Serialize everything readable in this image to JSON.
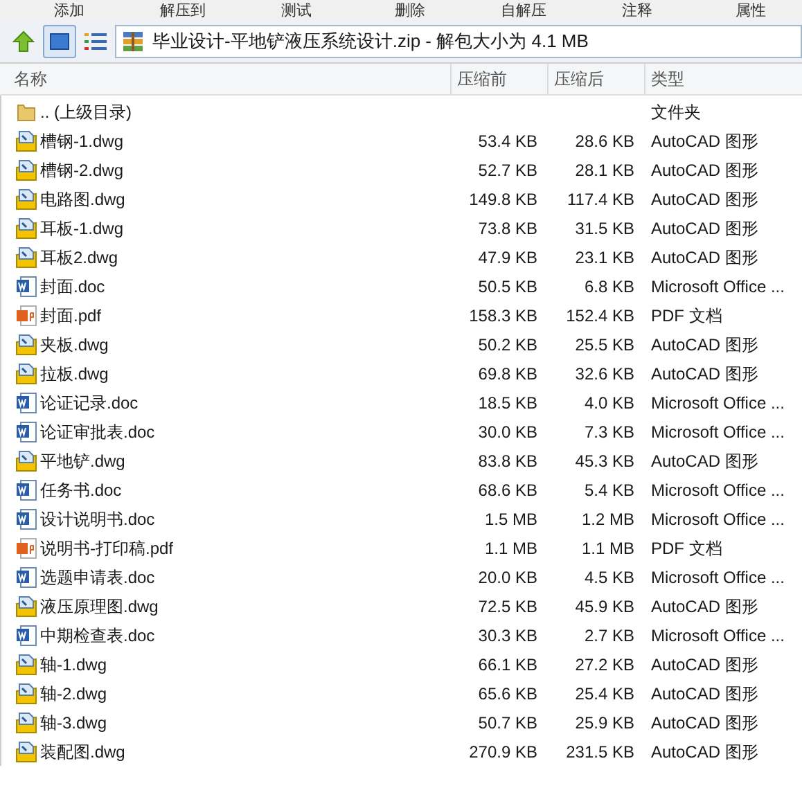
{
  "toolbar": [
    "添加",
    "解压到",
    "测试",
    "删除",
    "自解压",
    "注释",
    "属性"
  ],
  "address": "毕业设计-平地铲液压系统设计.zip - 解包大小为 4.1 MB",
  "columns": [
    "名称",
    "压缩前",
    "压缩后",
    "类型"
  ],
  "rows": [
    {
      "kind": "folder",
      "name": ".. (上级目录)",
      "type": "文件夹"
    },
    {
      "kind": "dwg",
      "name": "槽钢-1.dwg",
      "size": "53.4 KB",
      "packed": "28.6 KB",
      "type": "AutoCAD 图形"
    },
    {
      "kind": "dwg",
      "name": "槽钢-2.dwg",
      "size": "52.7 KB",
      "packed": "28.1 KB",
      "type": "AutoCAD 图形"
    },
    {
      "kind": "dwg",
      "name": "电路图.dwg",
      "size": "149.8 KB",
      "packed": "117.4 KB",
      "type": "AutoCAD 图形"
    },
    {
      "kind": "dwg",
      "name": "耳板-1.dwg",
      "size": "73.8 KB",
      "packed": "31.5 KB",
      "type": "AutoCAD 图形"
    },
    {
      "kind": "dwg",
      "name": "耳板2.dwg",
      "size": "47.9 KB",
      "packed": "23.1 KB",
      "type": "AutoCAD 图形"
    },
    {
      "kind": "doc",
      "name": "封面.doc",
      "size": "50.5 KB",
      "packed": "6.8 KB",
      "type": "Microsoft Office ..."
    },
    {
      "kind": "pdf",
      "name": "封面.pdf",
      "size": "158.3 KB",
      "packed": "152.4 KB",
      "type": "PDF 文档"
    },
    {
      "kind": "dwg",
      "name": "夹板.dwg",
      "size": "50.2 KB",
      "packed": "25.5 KB",
      "type": "AutoCAD 图形"
    },
    {
      "kind": "dwg",
      "name": "拉板.dwg",
      "size": "69.8 KB",
      "packed": "32.6 KB",
      "type": "AutoCAD 图形"
    },
    {
      "kind": "doc",
      "name": "论证记录.doc",
      "size": "18.5 KB",
      "packed": "4.0 KB",
      "type": "Microsoft Office ..."
    },
    {
      "kind": "doc",
      "name": "论证审批表.doc",
      "size": "30.0 KB",
      "packed": "7.3 KB",
      "type": "Microsoft Office ..."
    },
    {
      "kind": "dwg",
      "name": "平地铲.dwg",
      "size": "83.8 KB",
      "packed": "45.3 KB",
      "type": "AutoCAD 图形"
    },
    {
      "kind": "doc",
      "name": "任务书.doc",
      "size": "68.6 KB",
      "packed": "5.4 KB",
      "type": "Microsoft Office ..."
    },
    {
      "kind": "doc",
      "name": "设计说明书.doc",
      "size": "1.5 MB",
      "packed": "1.2 MB",
      "type": "Microsoft Office ..."
    },
    {
      "kind": "pdf",
      "name": "说明书-打印稿.pdf",
      "size": "1.1 MB",
      "packed": "1.1 MB",
      "type": "PDF 文档"
    },
    {
      "kind": "doc",
      "name": "选题申请表.doc",
      "size": "20.0 KB",
      "packed": "4.5 KB",
      "type": "Microsoft Office ..."
    },
    {
      "kind": "dwg",
      "name": "液压原理图.dwg",
      "size": "72.5 KB",
      "packed": "45.9 KB",
      "type": "AutoCAD 图形"
    },
    {
      "kind": "doc",
      "name": "中期检查表.doc",
      "size": "30.3 KB",
      "packed": "2.7 KB",
      "type": "Microsoft Office ..."
    },
    {
      "kind": "dwg",
      "name": "轴-1.dwg",
      "size": "66.1 KB",
      "packed": "27.2 KB",
      "type": "AutoCAD 图形"
    },
    {
      "kind": "dwg",
      "name": "轴-2.dwg",
      "size": "65.6 KB",
      "packed": "25.4 KB",
      "type": "AutoCAD 图形"
    },
    {
      "kind": "dwg",
      "name": "轴-3.dwg",
      "size": "50.7 KB",
      "packed": "25.9 KB",
      "type": "AutoCAD 图形"
    },
    {
      "kind": "dwg",
      "name": "装配图.dwg",
      "size": "270.9 KB",
      "packed": "231.5 KB",
      "type": "AutoCAD 图形"
    }
  ]
}
